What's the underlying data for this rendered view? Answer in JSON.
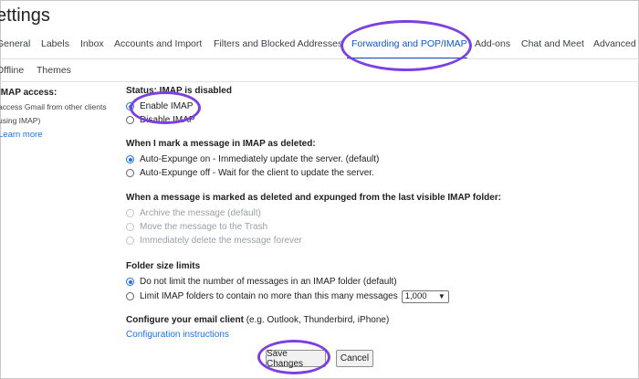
{
  "page_title": "ettings",
  "tabs": [
    {
      "label": "General"
    },
    {
      "label": "Labels"
    },
    {
      "label": "Inbox"
    },
    {
      "label": "Accounts and Import"
    },
    {
      "label": "Filters and Blocked Addresses"
    },
    {
      "label": "Forwarding and POP/IMAP"
    },
    {
      "label": "Add-ons"
    },
    {
      "label": "Chat and Meet"
    },
    {
      "label": "Advanced"
    }
  ],
  "tabs_row2": [
    {
      "label": "Offline"
    },
    {
      "label": "Themes"
    }
  ],
  "left": {
    "title": "IMAP access:",
    "desc1": "access Gmail from other clients",
    "desc2": "using IMAP)",
    "link": "Learn more"
  },
  "imap_status": {
    "title": "Status: IMAP is disabled",
    "options": [
      "Enable IMAP",
      "Disable IMAP"
    ]
  },
  "deleted_section": {
    "title": "When I mark a message in IMAP as deleted:",
    "options": [
      "Auto-Expunge on - Immediately update the server. (default)",
      "Auto-Expunge off - Wait for the client to update the server."
    ]
  },
  "expunged_section": {
    "title": "When a message is marked as deleted and expunged from the last visible IMAP folder:",
    "options": [
      "Archive the message (default)",
      "Move the message to the Trash",
      "Immediately delete the message forever"
    ]
  },
  "folder_section": {
    "title": "Folder size limits",
    "options": [
      "Do not limit the number of messages in an IMAP folder (default)",
      "Limit IMAP folders to contain no more than this many messages"
    ],
    "select_value": "1,000"
  },
  "configure_section": {
    "title": "Configure your email client",
    "subtitle": "(e.g. Outlook, Thunderbird, iPhone)",
    "link": "Configuration instructions"
  },
  "buttons": {
    "save": "Save Changes",
    "cancel": "Cancel"
  },
  "colors": {
    "accent": "#1a73e8",
    "annotation": "#7b3fe4"
  }
}
